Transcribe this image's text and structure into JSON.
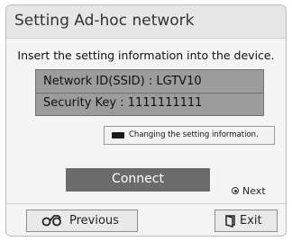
{
  "dialog": {
    "title": "Setting Ad-hoc network",
    "instruction": "Insert the setting information into the device.",
    "info": {
      "network_id": "Network ID(SSID) : LGTV10",
      "security_key": "Security Key : 1111111111"
    },
    "change_button": {
      "label": "Changing the setting information.",
      "icon": "blue-button-icon"
    },
    "connect_label": "Connect",
    "next_hint": {
      "icon": "radio-selected-icon",
      "label": "Next"
    },
    "previous_button": {
      "label": "Previous",
      "icon": "back-arrow-icon"
    },
    "exit_button": {
      "label": "Exit",
      "icon": "exit-door-icon"
    }
  },
  "colors": {
    "dialog_bg": "#f4f4f4",
    "title_bar_bg": "#e6e6e6",
    "info_box_bg": "#9c9c9c",
    "connect_bg": "#6b6b6b"
  }
}
